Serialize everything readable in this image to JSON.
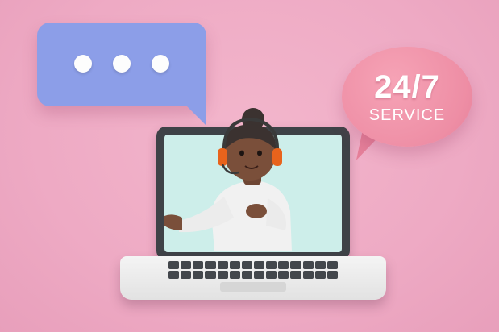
{
  "service_badge": {
    "main": "24/7",
    "sub": "SERVICE"
  },
  "colors": {
    "background": "#eeaac4",
    "chat_bubble": "#8c9ee8",
    "service_bubble": "#ee8ea5",
    "screen": "#cdeeea",
    "headset": "#e8631c"
  },
  "icons": [
    "chat-bubble-icon",
    "typing-dots-icon",
    "headset-icon",
    "laptop-icon"
  ]
}
